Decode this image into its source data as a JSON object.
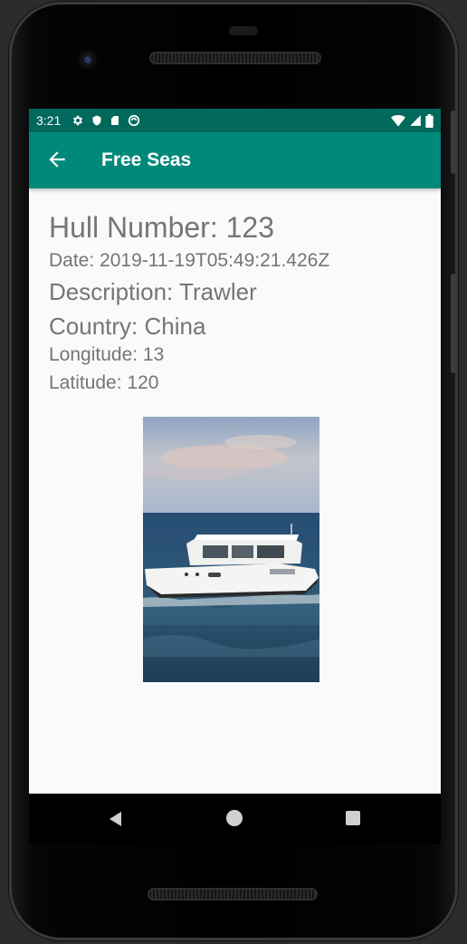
{
  "status_bar": {
    "time": "3:21",
    "left_icons": [
      "settings-icon",
      "shield-icon",
      "sd-card-icon",
      "sync-icon"
    ],
    "right_icons": [
      "wifi-icon",
      "signal-icon",
      "battery-icon"
    ]
  },
  "app_bar": {
    "title": "Free Seas",
    "back_icon": "arrow-back-icon"
  },
  "details": {
    "hull_number": "Hull Number: 123",
    "date": "Date: 2019-11-19T05:49:21.426Z",
    "description": "Description: Trawler",
    "country": "Country: China",
    "longitude": "Longitude: 13",
    "latitude": "Latitude: 120"
  },
  "colors": {
    "status_bar": "#00695c",
    "app_bar": "#00897b",
    "text": "#757575",
    "background": "#fafafa"
  },
  "navigation": [
    "back-icon",
    "home-icon",
    "recents-icon"
  ]
}
